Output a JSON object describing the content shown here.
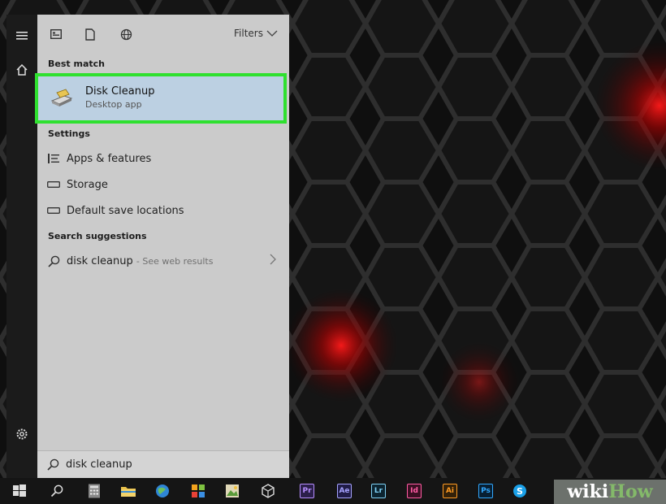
{
  "panel": {
    "filters_label": "Filters",
    "best_match_label": "Best match",
    "best_match_item": {
      "title": "Disk Cleanup",
      "subtitle": "Desktop app"
    },
    "settings_label": "Settings",
    "settings_items": [
      {
        "label": "Apps & features",
        "icon": "list-icon"
      },
      {
        "label": "Storage",
        "icon": "storage-icon"
      },
      {
        "label": "Default save locations",
        "icon": "storage-icon"
      }
    ],
    "suggestions_label": "Search suggestions",
    "suggestion": {
      "query": "disk cleanup",
      "note": "- See web results"
    }
  },
  "search": {
    "value": "disk cleanup"
  },
  "taskbar": {
    "apps": [
      {
        "name": "Pr",
        "color": "#2b1f4a",
        "fg": "#b78eff"
      },
      {
        "name": "Ae",
        "color": "#201c48",
        "fg": "#a6a3ff"
      },
      {
        "name": "Lr",
        "color": "#0c2430",
        "fg": "#7fd0f4"
      },
      {
        "name": "Id",
        "color": "#3a0f22",
        "fg": "#ff5ba3"
      },
      {
        "name": "Ai",
        "color": "#332109",
        "fg": "#ff9b23"
      },
      {
        "name": "Ps",
        "color": "#071f33",
        "fg": "#31a8ff"
      }
    ]
  },
  "watermark": {
    "part1": "wiki",
    "part2": "How"
  }
}
